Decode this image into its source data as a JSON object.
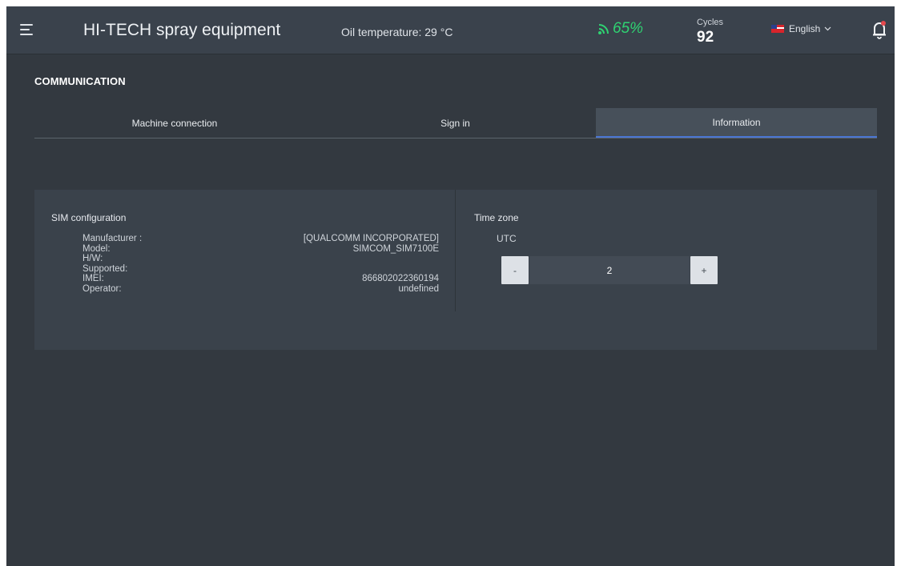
{
  "header": {
    "app_title": "HI-TECH spray equipment",
    "oil_temperature": "Oil temperature: 29 °C",
    "signal_percent": "65%",
    "cycles_label": "Cycles",
    "cycles_value": "92",
    "language": "English",
    "colors": {
      "signal": "#2fd372",
      "bar": "#3a424c"
    }
  },
  "page": {
    "title": "COMMUNICATION",
    "tabs": [
      {
        "label": "Machine connection",
        "active": false
      },
      {
        "label": "Sign in",
        "active": false
      },
      {
        "label": "Information",
        "active": true
      }
    ]
  },
  "sim": {
    "title": "SIM configuration",
    "rows": [
      {
        "label": "Manufacturer :",
        "value": "[QUALCOMM INCORPORATED]"
      },
      {
        "label": "Model:",
        "value": "SIMCOM_SIM7100E"
      },
      {
        "label": "H/W:",
        "value": ""
      },
      {
        "label": "Supported:",
        "value": ""
      },
      {
        "label": "IMEI:",
        "value": "866802022360194"
      },
      {
        "label": "Operator:",
        "value": "undefined"
      }
    ]
  },
  "timezone": {
    "title": "Time zone",
    "label": "UTC",
    "value": "2",
    "decrement_label": "-",
    "increment_label": "+"
  },
  "icons": {
    "menu": "menu-icon",
    "signal": "signal-icon",
    "flag": "us-flag-icon",
    "caret": "chevron-down-icon",
    "bell": "bell-icon"
  }
}
